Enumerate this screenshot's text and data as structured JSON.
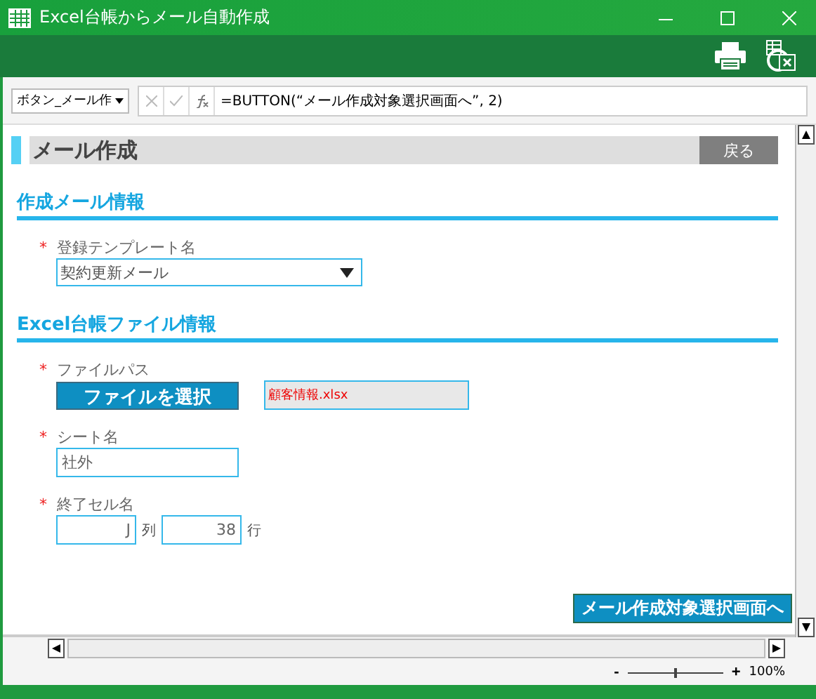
{
  "window": {
    "title": "Excel台帳からメール自動作成"
  },
  "formula_bar": {
    "name_box": "ボタン_メール作",
    "formula": "=BUTTON(“メール作成対象選択画面へ”, 2)"
  },
  "page": {
    "heading": "メール作成",
    "back_button": "戻る",
    "required_mark": "*",
    "sections": [
      {
        "title": "作成メール情報",
        "fields": [
          {
            "kind": "select",
            "label": "登録テンプレート名",
            "required": true,
            "value": "契約更新メール"
          }
        ]
      },
      {
        "title": "Excel台帳ファイル情報",
        "fields": [
          {
            "kind": "file",
            "label": "ファイルパス",
            "required": true,
            "button": "ファイルを選択",
            "value": "顧客情報.xlsx"
          },
          {
            "kind": "text",
            "label": "シート名",
            "required": true,
            "value": "社外"
          },
          {
            "kind": "cell",
            "label": "終了セル名",
            "required": true,
            "column": "J",
            "column_unit": "列",
            "row": "38",
            "row_unit": "行"
          }
        ]
      }
    ],
    "next_button": "メール作成対象選択画面へ"
  },
  "status_bar": {
    "zoom_out": "-",
    "zoom_in": "+",
    "zoom": "100%",
    "zoom_slider": {
      "level": 0.5
    }
  }
}
